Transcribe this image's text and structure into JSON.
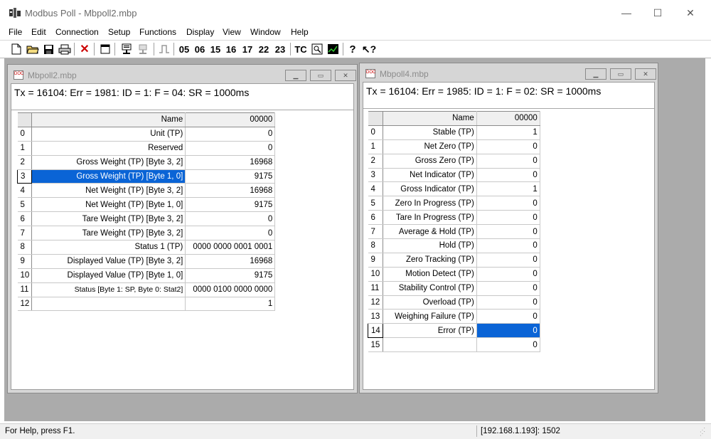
{
  "app": {
    "title": "Modbus Poll - Mbpoll2.mbp",
    "window_controls": {
      "minimize": "—",
      "maximize": "☐",
      "close": "✕"
    }
  },
  "menu": [
    "File",
    "Edit",
    "Connection",
    "Setup",
    "Functions",
    "Display",
    "View",
    "Window",
    "Help"
  ],
  "toolbar": {
    "function_codes": [
      "05",
      "06",
      "15",
      "16",
      "17",
      "22",
      "23"
    ],
    "tc_label": "TC"
  },
  "windows": [
    {
      "title": "Mbpoll2.mbp",
      "status": "Tx = 16104: Err = 1981: ID = 1: F = 04: SR = 1000ms",
      "header": {
        "name": "Name",
        "address": "00000"
      },
      "rows": [
        {
          "idx": "0",
          "name": "Unit (TP)",
          "value": "0"
        },
        {
          "idx": "1",
          "name": "Reserved",
          "value": "0"
        },
        {
          "idx": "2",
          "name": "Gross Weight (TP) [Byte 3, 2]",
          "value": "16968"
        },
        {
          "idx": "3",
          "name": "Gross Weight (TP) [Byte 1, 0]",
          "value": "9175"
        },
        {
          "idx": "4",
          "name": "Net Weight (TP) [Byte 3, 2]",
          "value": "16968"
        },
        {
          "idx": "5",
          "name": "Net Weight (TP) [Byte 1, 0]",
          "value": "9175"
        },
        {
          "idx": "6",
          "name": "Tare Weight (TP) [Byte 3, 2]",
          "value": "0"
        },
        {
          "idx": "7",
          "name": "Tare Weight (TP) [Byte 3, 2]",
          "value": "0"
        },
        {
          "idx": "8",
          "name": "Status 1 (TP)",
          "value": "0000 0000 0001 0001"
        },
        {
          "idx": "9",
          "name": "Displayed Value (TP) [Byte 3, 2]",
          "value": "16968"
        },
        {
          "idx": "10",
          "name": "Displayed Value (TP) [Byte 1, 0]",
          "value": "9175"
        },
        {
          "idx": "11",
          "name": "Status  [Byte 1: SP, Byte 0: Stat2]",
          "value": "0000 0100 0000 0000"
        },
        {
          "idx": "12",
          "name": "",
          "value": "1"
        }
      ]
    },
    {
      "title": "Mbpoll4.mbp",
      "status": "Tx = 16104: Err = 1985: ID = 1: F = 02: SR = 1000ms",
      "header": {
        "name": "Name",
        "address": "00000"
      },
      "rows": [
        {
          "idx": "0",
          "name": "Stable (TP)",
          "value": "1"
        },
        {
          "idx": "1",
          "name": "Net Zero (TP)",
          "value": "0"
        },
        {
          "idx": "2",
          "name": "Gross Zero (TP)",
          "value": "0"
        },
        {
          "idx": "3",
          "name": "Net Indicator (TP)",
          "value": "0"
        },
        {
          "idx": "4",
          "name": "Gross Indicator (TP)",
          "value": "1"
        },
        {
          "idx": "5",
          "name": "Zero In Progress (TP)",
          "value": "0"
        },
        {
          "idx": "6",
          "name": "Tare In Progress (TP)",
          "value": "0"
        },
        {
          "idx": "7",
          "name": "Average & Hold (TP)",
          "value": "0"
        },
        {
          "idx": "8",
          "name": "Hold (TP)",
          "value": "0"
        },
        {
          "idx": "9",
          "name": "Zero Tracking (TP)",
          "value": "0"
        },
        {
          "idx": "10",
          "name": "Motion Detect (TP)",
          "value": "0"
        },
        {
          "idx": "11",
          "name": "Stability Control (TP)",
          "value": "0"
        },
        {
          "idx": "12",
          "name": "Overload (TP)",
          "value": "0"
        },
        {
          "idx": "13",
          "name": "Weighing Failure (TP)",
          "value": "0"
        },
        {
          "idx": "14",
          "name": "Error (TP)",
          "value": "0"
        },
        {
          "idx": "15",
          "name": "",
          "value": "0"
        }
      ]
    }
  ],
  "statusbar": {
    "help": "For Help, press F1.",
    "connection": "[192.168.1.193]: 1502"
  },
  "colors": {
    "selection": "#0a64d6",
    "mdi_background": "#ababab"
  }
}
